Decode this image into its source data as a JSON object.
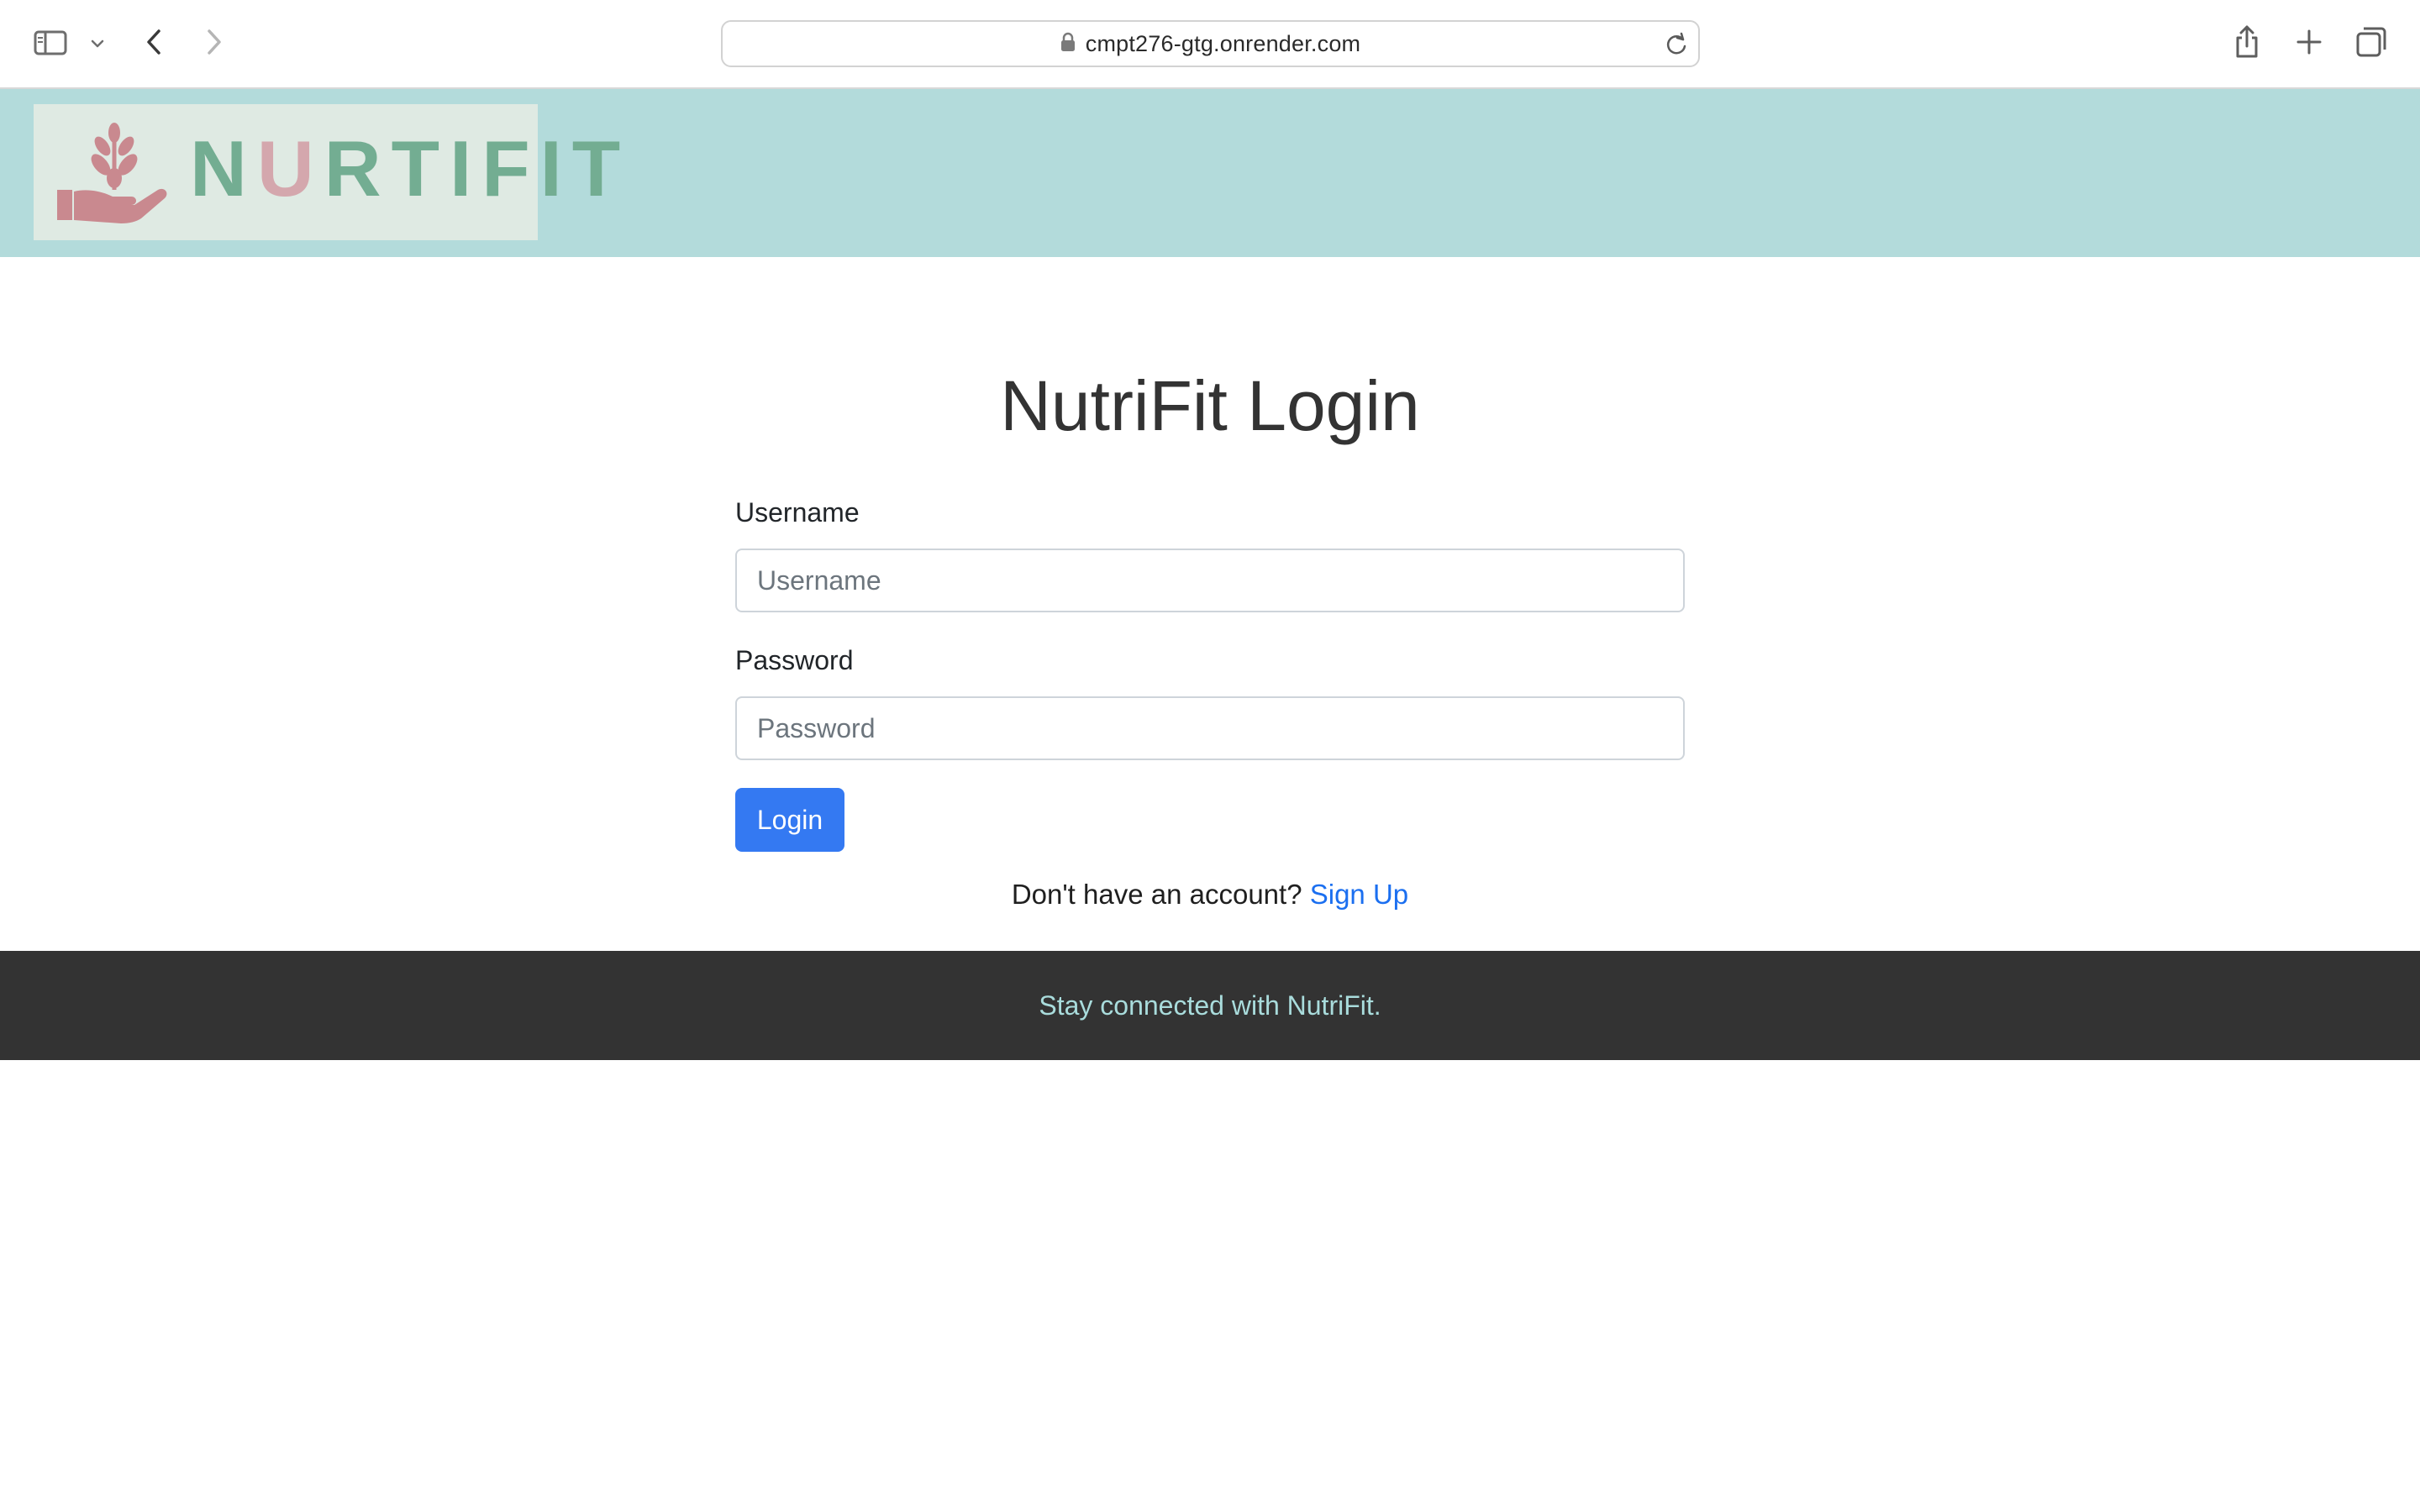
{
  "browser": {
    "url": "cmpt276-gtg.onrender.com",
    "icons": {
      "sidebar": "sidebar-icon",
      "sidebar_menu": "chevron-down-icon",
      "back": "chevron-left-icon",
      "forward": "chevron-right-icon",
      "lock": "lock-icon",
      "reload": "reload-icon",
      "share": "share-icon",
      "new_tab": "plus-icon",
      "tabs": "tab-overview-icon"
    }
  },
  "header": {
    "logo": {
      "wordmark_pre": "N",
      "wordmark_u": "U",
      "wordmark_post": "RTIFIT",
      "icon": "hand-wheat-icon"
    }
  },
  "main": {
    "title": "NutriFit Login",
    "username": {
      "label": "Username",
      "placeholder": "Username",
      "value": ""
    },
    "password": {
      "label": "Password",
      "placeholder": "Password",
      "value": ""
    },
    "login_label": "Login",
    "signup_prompt": "Don't have an account? ",
    "signup_link": "Sign Up"
  },
  "footer": {
    "text": "Stay connected with NutriFit."
  },
  "colors": {
    "header_bg": "#b3dbdb",
    "logo_bg": "#dfeae3",
    "logo_green": "#73ad92",
    "logo_pink": "#d4a7ad",
    "button": "#3479f2",
    "link": "#1b6ff0",
    "footer_bg": "#333333",
    "footer_text": "#a9dcdc"
  }
}
